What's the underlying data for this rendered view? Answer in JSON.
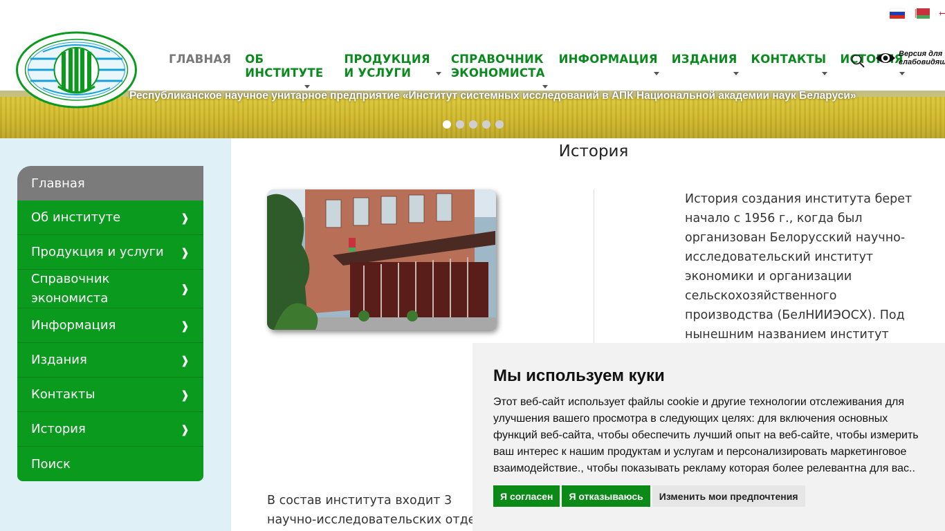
{
  "header": {
    "nav": [
      {
        "id": "home",
        "label": "ГЛАВНАЯ"
      },
      {
        "id": "about",
        "line1": "ОБ",
        "line2": "ИНСТИТУТЕ"
      },
      {
        "id": "products",
        "line1": "ПРОДУКЦИЯ",
        "line2": "И УСЛУГИ"
      },
      {
        "id": "reference",
        "line1": "СПРАВОЧНИК",
        "line2": "ЭКОНОМИСТА"
      },
      {
        "id": "info",
        "label": "ИНФОРМАЦИЯ"
      },
      {
        "id": "publications",
        "label": "ИЗДАНИЯ"
      },
      {
        "id": "contacts",
        "label": "КОНТАКТЫ"
      },
      {
        "id": "history",
        "label": "ИСТОРИЯ"
      }
    ],
    "vision": {
      "line1": "Версия для",
      "line2": "слабовидящ"
    },
    "icons": {
      "search": "search-icon",
      "vision": "eye-icon"
    }
  },
  "banner": {
    "title": "Республиканское научное унитарное предприятие «Институт системных исследований в АПК Национальной академии наук Беларуси»",
    "slides": 5,
    "active_slide": 1
  },
  "sidebar": {
    "items": [
      {
        "label": "Главная"
      },
      {
        "label": "Об институте",
        "arrow": "❱"
      },
      {
        "label": "Продукция и услуги",
        "arrow": "❱"
      },
      {
        "line1": "Справочник",
        "line2": "экономиста",
        "arrow": "❱"
      },
      {
        "label": "Информация",
        "arrow": "❱"
      },
      {
        "label": "Издания",
        "arrow": "❱"
      },
      {
        "label": "Контакты",
        "arrow": "❱"
      },
      {
        "label": "История",
        "arrow": "❱"
      },
      {
        "label": "Поиск"
      }
    ]
  },
  "content": {
    "title": "История",
    "history_text": "История создания института берет начало с 1956 г., когда был организован Белорусский научно-исследовательский институт экономики и организации сельскохозяйственного производства (БелНИИЭОСХ). Под нынешним названием институт",
    "bottom_line1": "В состав института входит 3",
    "bottom_line2": "научно-исследовательских отде"
  },
  "cookie": {
    "title": "Мы используем куки",
    "text": "Этот веб-сайт использует файлы cookie и другие технологии отслеживания для улучшения вашего просмотра в следующих целях: для включения основных функций веб-сайта, чтобы обеспечить лучший опыт на веб-сайте, чтобы измерить ваш интерес к нашим продуктам и услугам и персонализировать маркетинговое взаимодействие., чтобы показывать рекламу которая более релевантна для вас..",
    "accept": "Я согласен",
    "decline": "Я отказываюсь",
    "preferences": "Изменить мои предпочтения"
  },
  "colors": {
    "brand_green": "#0a9a1e",
    "nav_green": "#0a8a1e",
    "sidebar_bg": "#dff0f7",
    "home_gray": "#7b7b7b"
  }
}
